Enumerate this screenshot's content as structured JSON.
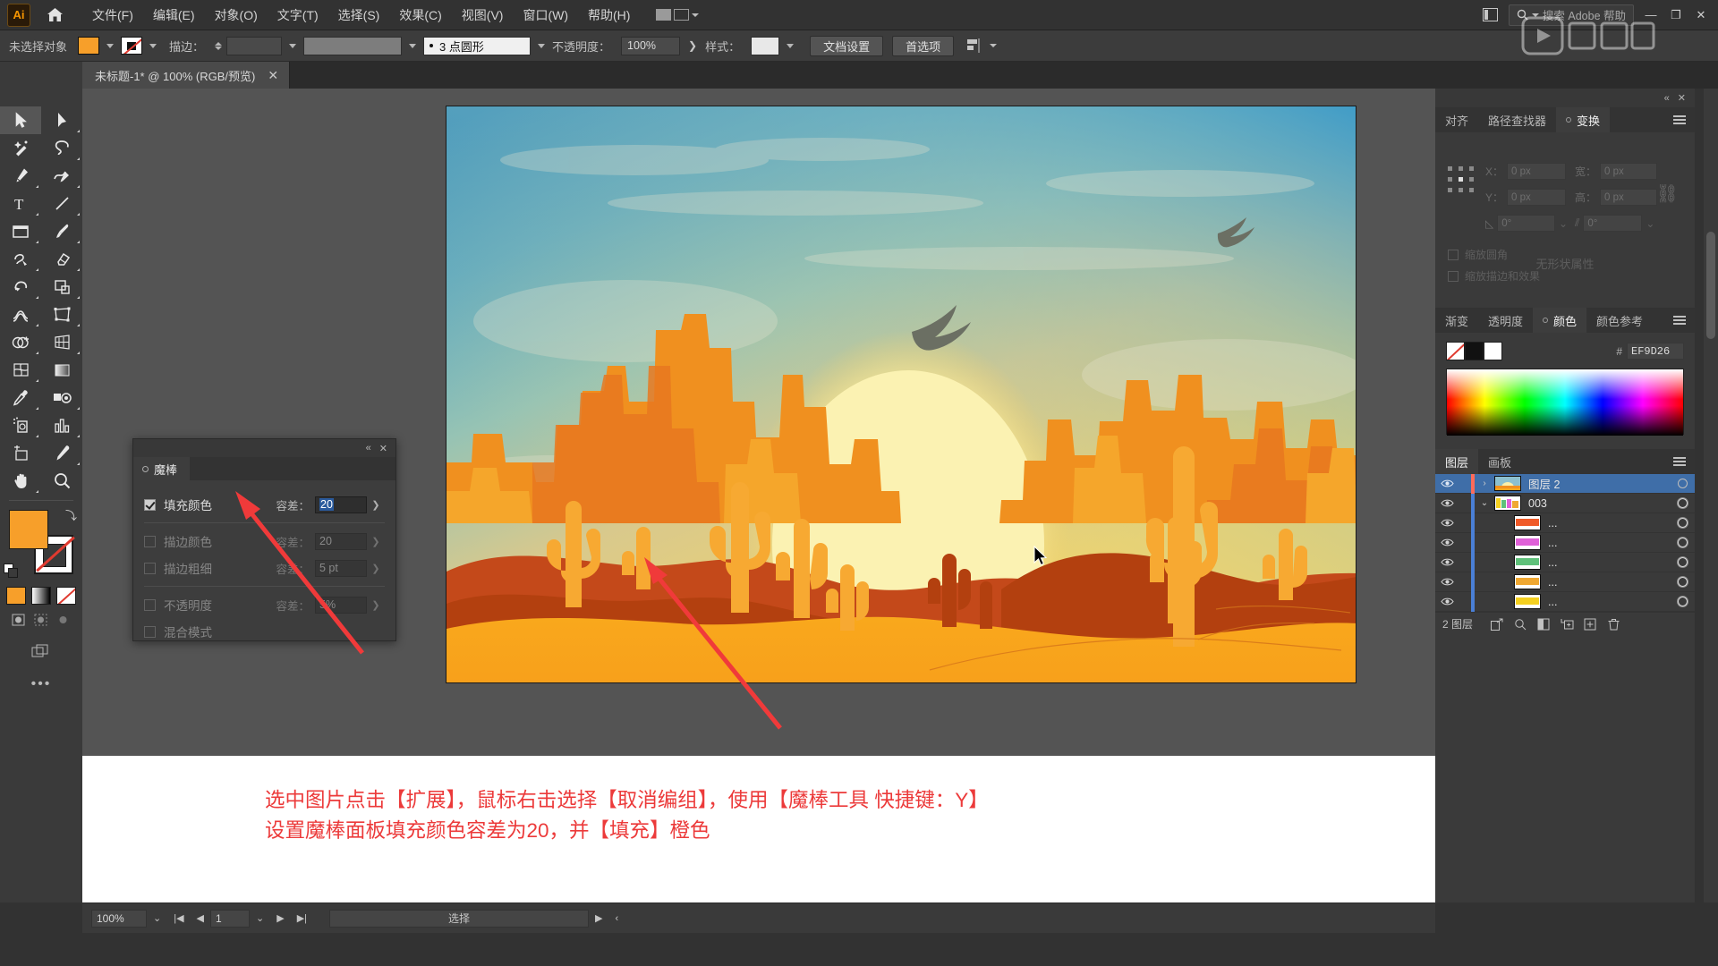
{
  "app": {
    "name": "Adobe Illustrator",
    "logo_text": "Ai"
  },
  "menubar": {
    "items": [
      {
        "label": "文件(F)",
        "name": "menu-file"
      },
      {
        "label": "编辑(E)",
        "name": "menu-edit"
      },
      {
        "label": "对象(O)",
        "name": "menu-object"
      },
      {
        "label": "文字(T)",
        "name": "menu-type"
      },
      {
        "label": "选择(S)",
        "name": "menu-select"
      },
      {
        "label": "效果(C)",
        "name": "menu-effect"
      },
      {
        "label": "视图(V)",
        "name": "menu-view"
      },
      {
        "label": "窗口(W)",
        "name": "menu-window"
      },
      {
        "label": "帮助(H)",
        "name": "menu-help"
      }
    ],
    "search_placeholder": "搜索 Adobe 帮助",
    "window_buttons": {
      "minimize": "—",
      "restore": "❐",
      "close": "✕"
    }
  },
  "controlbar": {
    "selection_label": "未选择对象",
    "stroke_label": "描边：",
    "stroke_width": "",
    "brush_label": "3 点圆形",
    "opacity_label": "不透明度：",
    "opacity_value": "100%",
    "style_label": "样式：",
    "doc_setup_button": "文档设置",
    "preferences_button": "首选项"
  },
  "tab": {
    "title": "未标题-1* @ 100% (RGB/预览)",
    "close": "✕"
  },
  "toolbar": {
    "tools": [
      {
        "name": "selection-tool",
        "label": "选择工具"
      },
      {
        "name": "direct-selection-tool",
        "label": "直接选择工具"
      },
      {
        "name": "magic-wand-tool",
        "label": "魔棒工具"
      },
      {
        "name": "lasso-tool",
        "label": "套索工具"
      },
      {
        "name": "pen-tool",
        "label": "钢笔工具"
      },
      {
        "name": "curvature-tool",
        "label": "曲率工具"
      },
      {
        "name": "type-tool",
        "label": "文字工具"
      },
      {
        "name": "line-segment-tool",
        "label": "直线段工具"
      },
      {
        "name": "rectangle-tool",
        "label": "矩形工具"
      },
      {
        "name": "paintbrush-tool",
        "label": "画笔工具"
      },
      {
        "name": "shaper-tool",
        "label": "Shaper 工具"
      },
      {
        "name": "eraser-tool",
        "label": "橡皮擦工具"
      },
      {
        "name": "rotate-tool",
        "label": "旋转工具"
      },
      {
        "name": "scale-tool",
        "label": "比例缩放工具"
      },
      {
        "name": "width-tool",
        "label": "宽度工具"
      },
      {
        "name": "free-transform-tool",
        "label": "自由变换工具"
      },
      {
        "name": "shape-builder-tool",
        "label": "形状生成器工具"
      },
      {
        "name": "perspective-grid-tool",
        "label": "透视网格工具"
      },
      {
        "name": "mesh-tool",
        "label": "网格工具"
      },
      {
        "name": "gradient-tool",
        "label": "渐变工具"
      },
      {
        "name": "eyedropper-tool",
        "label": "吸管工具"
      },
      {
        "name": "blend-tool",
        "label": "混合工具"
      },
      {
        "name": "symbol-sprayer-tool",
        "label": "符号喷枪工具"
      },
      {
        "name": "column-graph-tool",
        "label": "柱形图工具"
      },
      {
        "name": "artboard-tool",
        "label": "画板工具"
      },
      {
        "name": "slice-tool",
        "label": "切片工具"
      },
      {
        "name": "hand-tool",
        "label": "抓手工具"
      },
      {
        "name": "zoom-tool",
        "label": "缩放工具"
      }
    ],
    "fill_color": "#F79F2A",
    "stroke_color": "#FFFFFF",
    "more_tools": "•••"
  },
  "magic_wand_panel": {
    "tab_label": "魔棒",
    "close": "✕",
    "collapse": "«",
    "rows": [
      {
        "name": "fill-color",
        "label": "填充颜色",
        "checked": true,
        "tolerance_label": "容差：",
        "tolerance_value": "20",
        "enabled": true
      },
      {
        "name": "stroke-color",
        "label": "描边颜色",
        "checked": false,
        "tolerance_label": "容差：",
        "tolerance_value": "20",
        "enabled": false
      },
      {
        "name": "stroke-weight",
        "label": "描边粗细",
        "checked": false,
        "tolerance_label": "容差：",
        "tolerance_value": "5 pt",
        "enabled": false
      },
      {
        "name": "opacity",
        "label": "不透明度",
        "checked": false,
        "tolerance_label": "容差：",
        "tolerance_value": "5%",
        "enabled": false
      },
      {
        "name": "blending-mode",
        "label": "混合模式",
        "checked": false,
        "tolerance_label": "",
        "tolerance_value": "",
        "enabled": false
      }
    ]
  },
  "transform_panel": {
    "tabs": [
      {
        "label": "对齐",
        "name": "tab-align",
        "active": false
      },
      {
        "label": "路径查找器",
        "name": "tab-pathfinder",
        "active": false
      },
      {
        "label": "变换",
        "name": "tab-transform",
        "active": true
      }
    ],
    "fields": [
      {
        "label": "X：",
        "value": "0 px",
        "name": "transform-x"
      },
      {
        "label": "宽：",
        "value": "0 px",
        "name": "transform-width"
      },
      {
        "label": "Y：",
        "value": "0 px",
        "name": "transform-y"
      },
      {
        "label": "高：",
        "value": "0 px",
        "name": "transform-height"
      }
    ],
    "angle_value": "0°",
    "shear_value": "0°",
    "empty_text": "无形状属性",
    "checks": [
      {
        "label": "缩放圆角",
        "name": "scale-corners-check"
      },
      {
        "label": "缩放描边和效果",
        "name": "scale-strokes-check"
      }
    ]
  },
  "color_panel": {
    "tabs": [
      {
        "label": "渐变",
        "name": "tab-gradient",
        "active": false
      },
      {
        "label": "透明度",
        "name": "tab-transparency",
        "active": false
      },
      {
        "label": "颜色",
        "name": "tab-color",
        "active": true
      },
      {
        "label": "颜色参考",
        "name": "tab-color-guide",
        "active": false
      }
    ],
    "hex_symbol": "#",
    "hex_value": "EF9D26",
    "swatches": [
      "none",
      "#111111",
      "#FFFFFF"
    ]
  },
  "layers_panel": {
    "tabs": [
      {
        "label": "图层",
        "name": "tab-layers",
        "active": true
      },
      {
        "label": "画板",
        "name": "tab-artboards",
        "active": false
      }
    ],
    "rows": [
      {
        "name": "图层 2",
        "indent": 0,
        "selected": true,
        "color": "#ff6b5a",
        "twisty": "›",
        "thumb": "sunset",
        "has_thumb": true
      },
      {
        "name": "003",
        "indent": 1,
        "selected": false,
        "color": "#4a7fd6",
        "twisty": "⌄",
        "thumb": "group",
        "has_thumb": true
      },
      {
        "name": "...",
        "indent": 2,
        "selected": false,
        "color": "#4a7fd6",
        "twisty": "",
        "thumb": "#f05a28",
        "has_thumb": true
      },
      {
        "name": "...",
        "indent": 2,
        "selected": false,
        "color": "#4a7fd6",
        "twisty": "",
        "thumb": "#e060d8",
        "has_thumb": true
      },
      {
        "name": "...",
        "indent": 2,
        "selected": false,
        "color": "#4a7fd6",
        "twisty": "",
        "thumb": "#5fc17a",
        "has_thumb": true
      },
      {
        "name": "...",
        "indent": 2,
        "selected": false,
        "color": "#4a7fd6",
        "twisty": "",
        "thumb": "#f0a832",
        "has_thumb": true
      },
      {
        "name": "...",
        "indent": 2,
        "selected": false,
        "color": "#4a7fd6",
        "twisty": "",
        "thumb": "#f5d020",
        "has_thumb": true
      }
    ],
    "footer_count": "2 图层",
    "footer_buttons": [
      {
        "name": "release-to-layers-button",
        "glyph": "⬈"
      },
      {
        "name": "locate-object-button",
        "glyph": "⌕"
      },
      {
        "name": "make-clipping-mask-button",
        "glyph": "◧"
      },
      {
        "name": "create-sublayer-button",
        "glyph": "⊞"
      },
      {
        "name": "create-new-layer-button",
        "glyph": "＋"
      },
      {
        "name": "delete-selection-button",
        "glyph": "🗑"
      }
    ]
  },
  "annotation": {
    "line1": "选中图片点击【扩展】，鼠标右击选择【取消编组】，使用【魔棒工具 快捷键：Y】",
    "line2": "设置魔棒面板填充颜色容差为20，并【填充】橙色",
    "color": "#EC3A3A"
  },
  "statusbar": {
    "zoom": "100%",
    "page": "1",
    "status": "选择",
    "nav_first": "|◀",
    "nav_prev": "◀",
    "nav_next": "▶",
    "nav_last": "▶|"
  },
  "artwork": {
    "title": "沙漠日落插画",
    "sky_top": "#3f9ac7",
    "sky_mid": "#a8c9b6",
    "sun": "#faf0a8",
    "dune_front": "#f9a01b",
    "dune_mid": "#c44a14",
    "mesa": "#f28420",
    "cactus": "#f7a832"
  }
}
